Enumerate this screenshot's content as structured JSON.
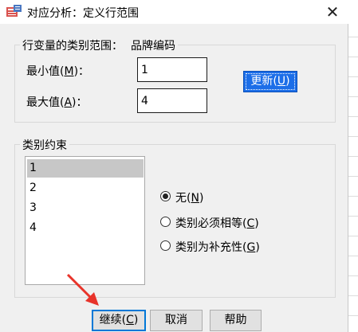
{
  "window": {
    "title": "对应分析：定义行范围",
    "close_symbol": "✕"
  },
  "row_range_group": {
    "legend": "行变量的类别范围：",
    "variable_name": "品牌编码",
    "min_label": "最小值(",
    "min_key": "M",
    "min_label_end": ")：",
    "min_value": "1",
    "max_label": "最大值(",
    "max_key": "A",
    "max_label_end": ")：",
    "max_value": "4",
    "update_label": "更新(",
    "update_key": "U",
    "update_label_end": ")"
  },
  "constraints_group": {
    "legend": "类别约束",
    "categories": [
      "1",
      "2",
      "3",
      "4"
    ],
    "selected_index": 0,
    "options": [
      {
        "label": "无(",
        "key": "N",
        "end": ")",
        "checked": true
      },
      {
        "label": "类别必须相等(",
        "key": "C",
        "end": ")",
        "checked": false
      },
      {
        "label": "类别为补充性(",
        "key": "G",
        "end": ")",
        "checked": false
      }
    ]
  },
  "footer": {
    "continue_label": "继续(",
    "continue_key": "C",
    "continue_label_end": ")",
    "cancel_label": "取消",
    "help_label": "帮助"
  },
  "icons": {
    "app": "spss-table-icon",
    "close": "close-icon",
    "annotation": "red-arrow-pointer"
  },
  "colors": {
    "accent": "#0078d7",
    "update_button": "#1c6ee8",
    "annotation_arrow": "#e8332a"
  }
}
